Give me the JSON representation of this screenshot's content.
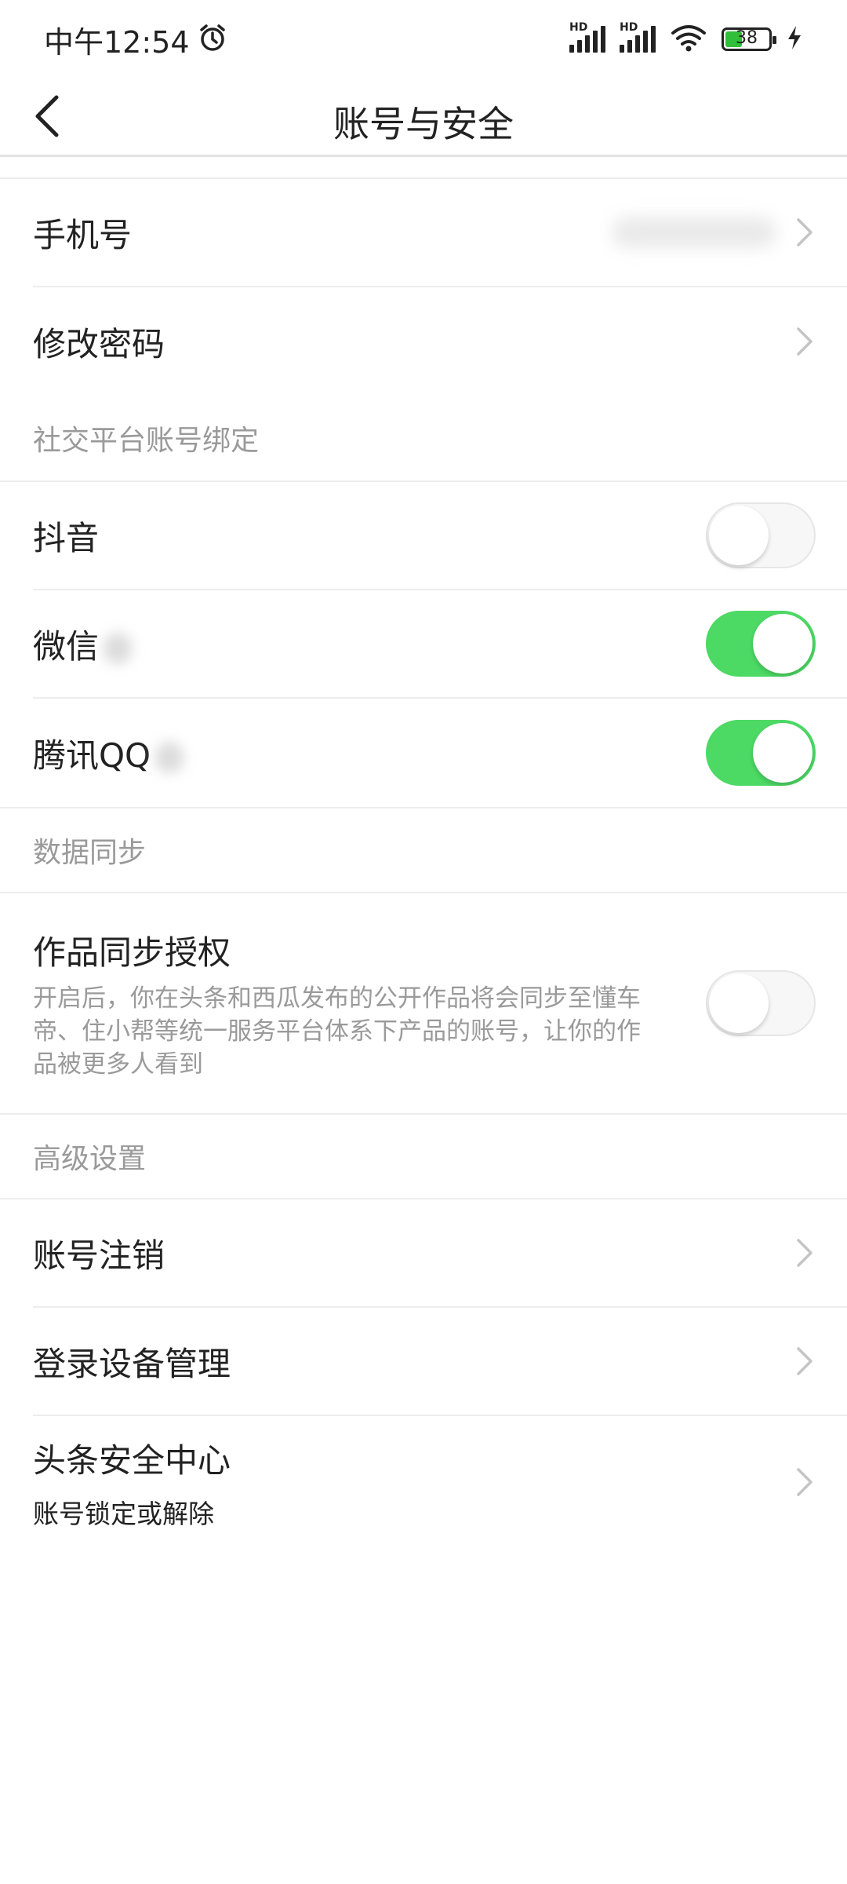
{
  "status_bar": {
    "time": "中午12:54",
    "alarm_icon": "alarm-clock-icon",
    "signal_label": "HD",
    "battery_level": "38",
    "battery_percent": 38
  },
  "header": {
    "title": "账号与安全",
    "back_icon": "chevron-left-icon"
  },
  "account": {
    "phone_label": "手机号",
    "password_label": "修改密码"
  },
  "social": {
    "section_title": "社交平台账号绑定",
    "items": [
      {
        "label": "抖音",
        "on": false
      },
      {
        "label": "微信",
        "on": true
      },
      {
        "label": "腾讯QQ",
        "on": true
      }
    ]
  },
  "sync": {
    "section_title": "数据同步",
    "label": "作品同步授权",
    "description": "开启后，你在头条和西瓜发布的公开作品将会同步至懂车帝、住小帮等统一服务平台体系下产品的账号，让你的作品被更多人看到",
    "on": false
  },
  "advanced": {
    "section_title": "高级设置",
    "cancel_label": "账号注销",
    "devices_label": "登录设备管理",
    "security_label": "头条安全中心",
    "security_sub": "账号锁定或解除"
  },
  "colors": {
    "toggle_on": "#4cd964",
    "battery": "#2fbf3b",
    "section_text": "#9a9a9a"
  }
}
